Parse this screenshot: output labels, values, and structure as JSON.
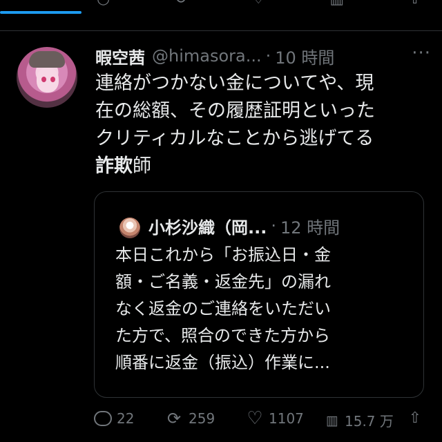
{
  "tweet": {
    "author_name": "暇空茜",
    "handle": "@himasora...",
    "separator": "·",
    "time": "10 時間",
    "more_icon": "more-horizontal-icon",
    "text_lines": [
      "連絡がつかない金についてや、現",
      "在の総額、その履歴証明といった",
      "クリティカルなことから逃げてる"
    ],
    "last_line_strong": "詐欺",
    "last_line_rest": "師"
  },
  "quote": {
    "author_name": "小杉沙織（岡...",
    "separator": "·",
    "time": "12 時間",
    "text_lines": [
      "本日これから「お振込日・金",
      "額・ご名義・返金先」の漏れ",
      "なく返金のご連絡をいただい",
      "た方で、照合のできた方から",
      "順番に返金（振込）作業に..."
    ]
  },
  "actions": {
    "replies": "22",
    "retweets": "259",
    "likes": "1107",
    "views": "15.7 万",
    "icons": [
      "reply-icon",
      "retweet-icon",
      "like-icon",
      "views-icon",
      "share-icon"
    ]
  },
  "colors": {
    "background": "#000000",
    "text": "#e7e9ea",
    "muted": "#71767b",
    "border": "#2f3336",
    "accent": "#1d9bf0"
  }
}
